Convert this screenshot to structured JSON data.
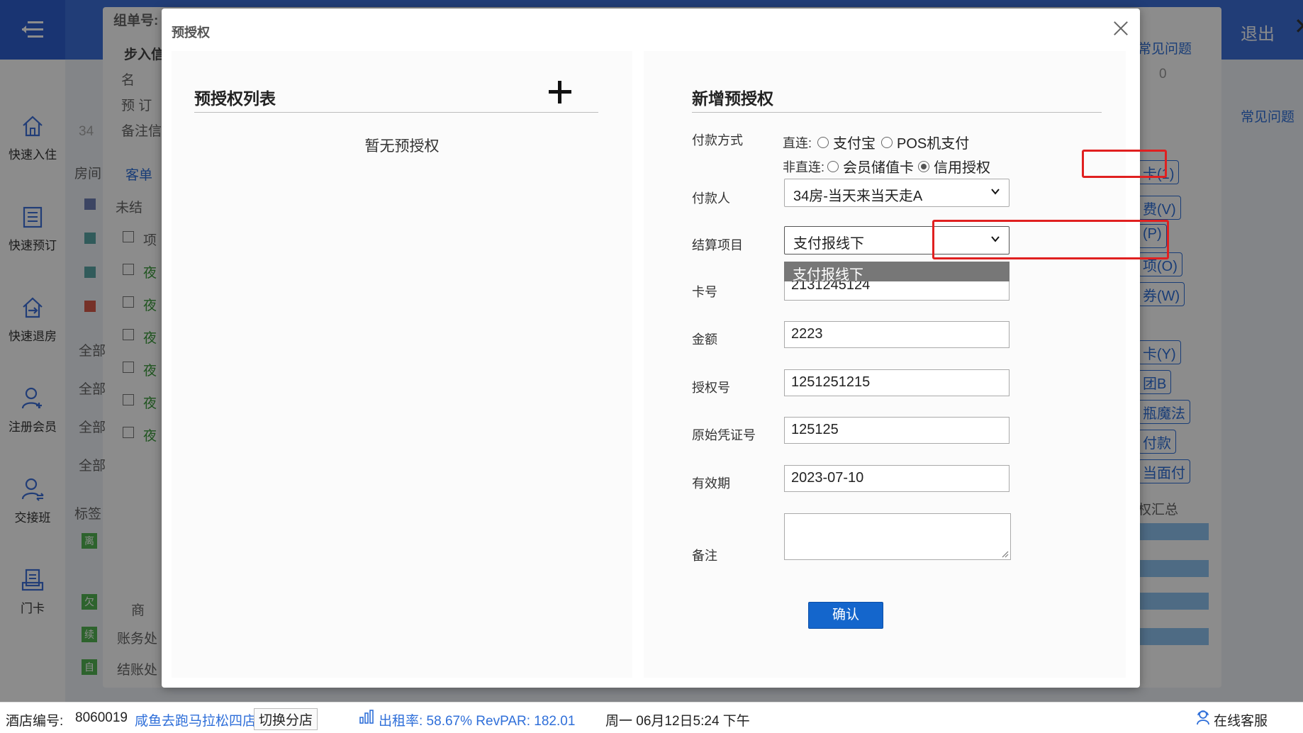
{
  "app": {
    "logout": "退出",
    "sidebar": [
      "快速入住",
      "快速预订",
      "快速退房",
      "注册会员",
      "交接班",
      "门卡"
    ]
  },
  "background": {
    "group_no": "组单号:",
    "step_in": "步入信",
    "name_frag": "名",
    "reserve_frag": "预 订",
    "remark_frag": "备注信",
    "room_frag": "房间",
    "bill_tab": "客单",
    "unsettled": "未结",
    "item_frag": "项",
    "night_frag": "夜",
    "all_frag": "全部",
    "tag_frag": "标签",
    "goods_frag": "商",
    "account_frag": "账务处",
    "checkout_frag": "结账处",
    "faq": "常见问题",
    "num_34": "34",
    "zero": "0",
    "tags": [
      "离",
      "欠",
      "续",
      "自"
    ],
    "right_buttons": [
      "卡(1)",
      "费(V)",
      "(P)",
      "项(O)",
      "券(W)",
      "卡(Y)",
      "团B",
      "瓶魔法",
      "付款",
      "当面付",
      "权汇总"
    ]
  },
  "modal": {
    "title": "预授权",
    "list_title": "预授权列表",
    "empty_text": "暂无预授权",
    "form_title": "新增预授权",
    "payment_method_label": "付款方式",
    "direct_prefix": "直连:",
    "direct_options": [
      "支付宝",
      "POS机支付"
    ],
    "indirect_prefix": "非直连:",
    "indirect_options": [
      "会员储值卡",
      "信用授权"
    ],
    "selected_option": "信用授权",
    "payer_label": "付款人",
    "payer_value": "34房-当天来当天走A",
    "settle_label": "结算项目",
    "settle_value": "支付报线下",
    "settle_dropdown_option": "支付报线下",
    "card_label": "卡号",
    "card_value": "2131245124",
    "amount_label": "金额",
    "amount_value": "2223",
    "auth_label": "授权号",
    "auth_value": "1251251215",
    "voucher_label": "原始凭证号",
    "voucher_value": "125125",
    "expiry_label": "有效期",
    "expiry_value": "2023-07-10",
    "remark_label": "备注",
    "remark_value": "",
    "confirm_label": "确认"
  },
  "statusbar": {
    "hotel_no_label": "酒店编号:",
    "hotel_no": "8060019",
    "hotel_name": "咸鱼去跑马拉松四店",
    "switch_branch": "切换分店",
    "occupancy": "出租率: 58.67% RevPAR: 182.01",
    "datetime": "周一 06月12日5:24 下午",
    "online_service": "在线客服"
  },
  "colors": {
    "topbar": "#3d6fd9",
    "primary_button": "#1466cc",
    "highlight": "#e02020",
    "link": "#2f6fd9"
  }
}
